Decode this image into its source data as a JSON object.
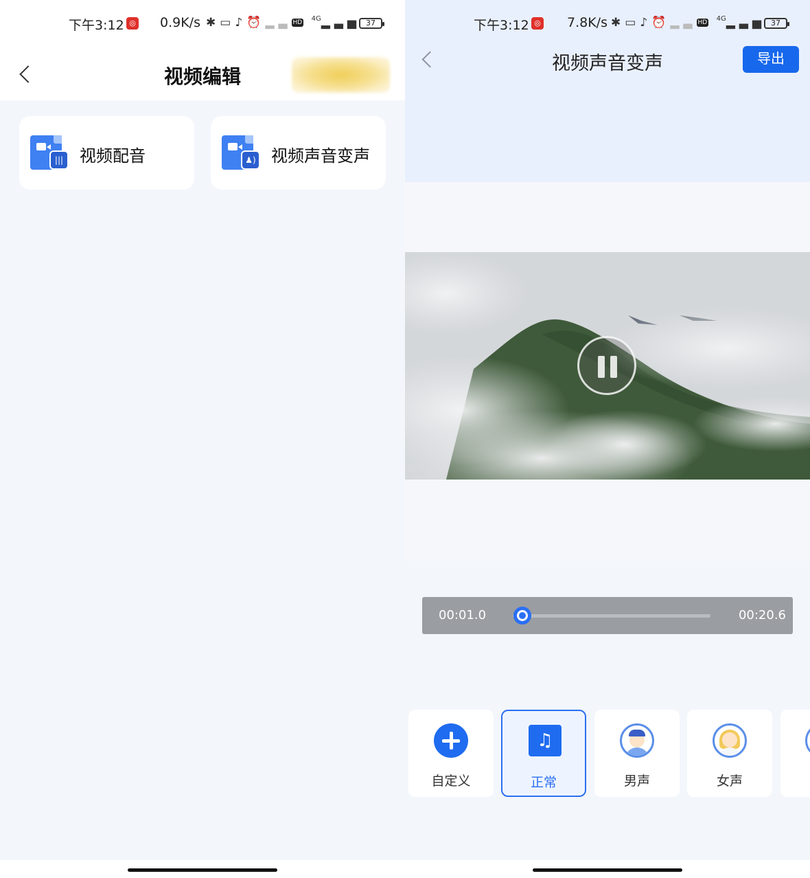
{
  "left_screen": {
    "status": {
      "time": "下午3:12",
      "speed": "0.9K/s",
      "battery": "37",
      "network": "4G",
      "hd": "HD"
    },
    "header": {
      "title": "视频编辑"
    },
    "cards": [
      {
        "label": "视频配音"
      },
      {
        "label": "视频声音变声"
      }
    ]
  },
  "right_screen": {
    "status": {
      "time": "下午3:12",
      "speed": "7.8K/s",
      "battery": "37",
      "network": "4G",
      "hd": "HD"
    },
    "header": {
      "title": "视频声音变声",
      "export_label": "导出"
    },
    "player": {
      "current_time": "00:01.0",
      "total_time": "00:20.6",
      "progress_fraction": 0.05
    },
    "voice_options": [
      {
        "label": "自定义",
        "icon": "plus-circle-icon",
        "selected": false
      },
      {
        "label": "正常",
        "icon": "music-note-icon",
        "selected": true
      },
      {
        "label": "男声",
        "icon": "male-avatar-icon",
        "selected": false
      },
      {
        "label": "女声",
        "icon": "female-avatar-icon",
        "selected": false
      }
    ]
  },
  "colors": {
    "accent": "#1768ec",
    "background": "#f3f6fb",
    "header_tint": "#e9f0fd"
  }
}
